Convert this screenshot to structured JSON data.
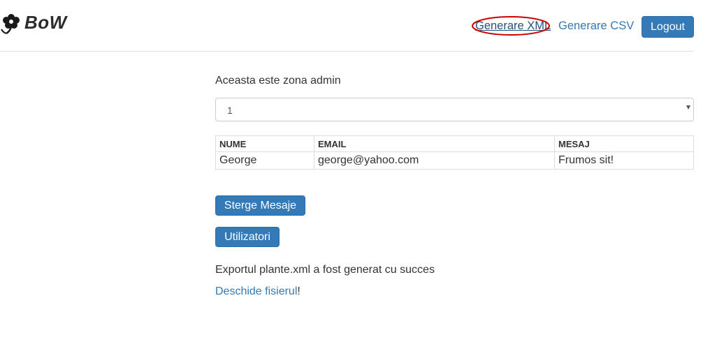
{
  "header": {
    "brand": "BoW",
    "nav": {
      "xml_label": "Generare XML",
      "csv_label": "Generare CSV",
      "logout_label": "Logout"
    },
    "highlight_color": "#cc0000"
  },
  "main": {
    "admin_text": "Aceasta este zona admin",
    "select": {
      "selected": "1"
    },
    "table": {
      "headers": [
        "NUME",
        "EMAIL",
        "MESAJ"
      ],
      "rows": [
        [
          "George",
          "george@yahoo.com",
          "Frumos sit!"
        ]
      ]
    },
    "buttons": {
      "delete_label": "Sterge Mesaje",
      "users_label": "Utilizatori"
    },
    "export_message": "Exportul plante.xml a fost generat cu succes",
    "open_link_label": "Deschide fisierul",
    "open_link_suffix": "!"
  },
  "colors": {
    "primary": "#337ab7",
    "link": "#337ab7",
    "text": "#333333"
  }
}
